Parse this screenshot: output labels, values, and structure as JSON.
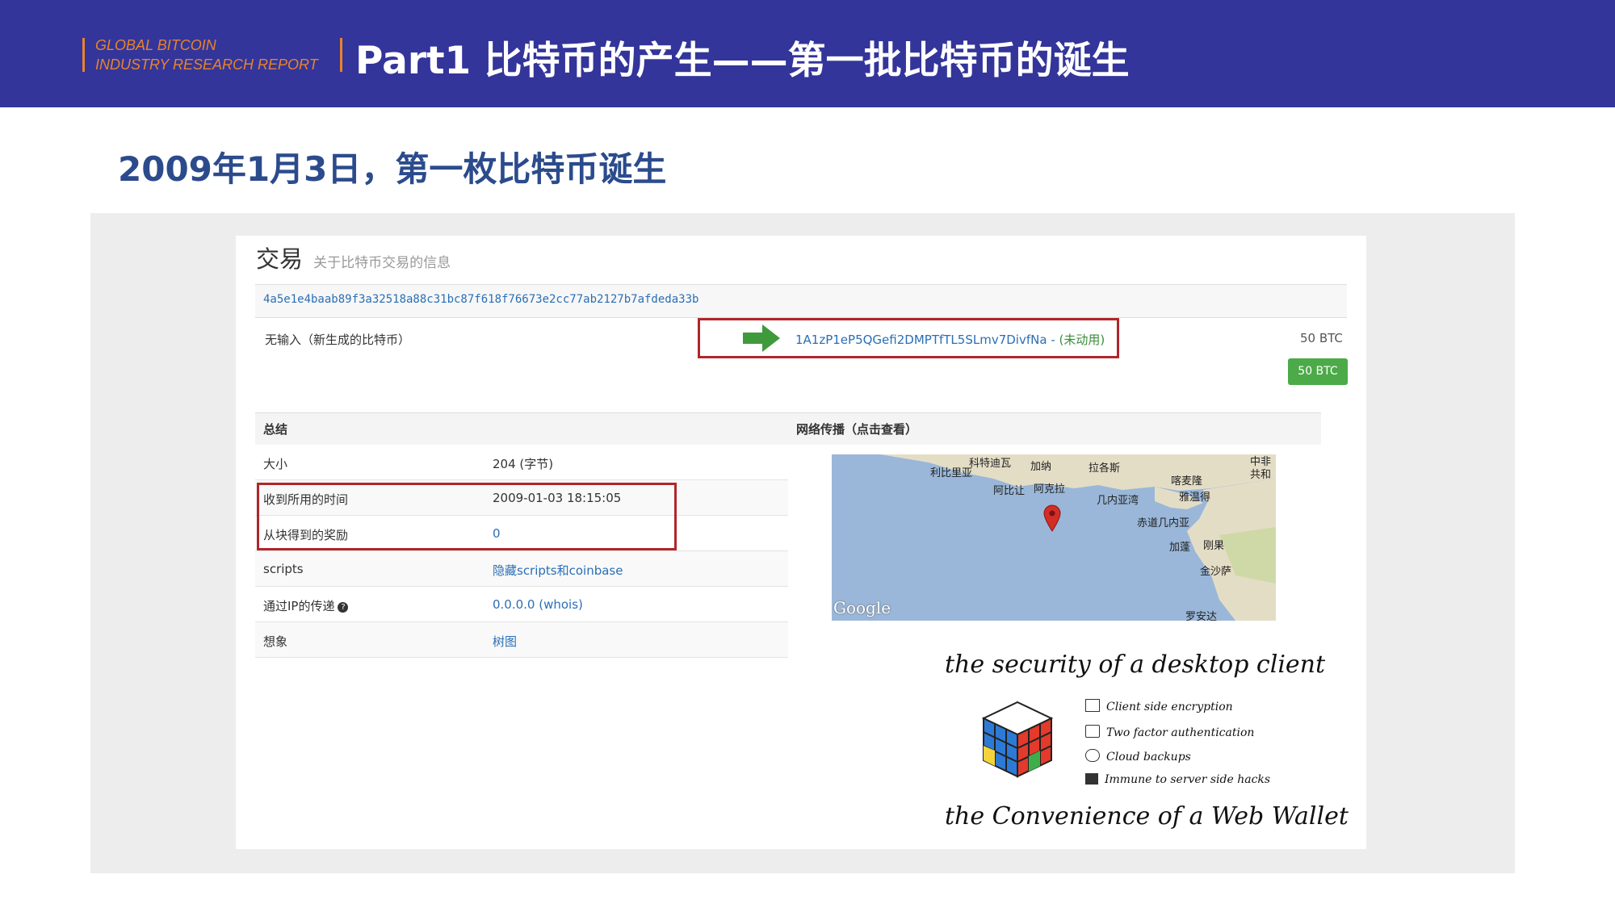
{
  "header": {
    "brand_line1": "GLOBAL BITCOIN",
    "brand_line2": "INDUSTRY RESEARCH REPORT",
    "title": "Part1 比特币的产生——第一批比特币的诞生"
  },
  "subtitle": "2009年1月3日，第一枚比特币诞生",
  "screenshot": {
    "tx_title": "交易",
    "tx_subtitle": "关于比特币交易的信息",
    "tx_hash": "4a5e1e4baab89f3a32518a88c31bc87f618f76673e2cc77ab2127b7afdeda33b",
    "input_label": "无输入（新生成的比特币）",
    "output_address": "1A1zP1eP5QGefi2DMPTfTL5SLmv7DivfNa",
    "output_status": "(未动用)",
    "output_amount": "50 BTC",
    "total_button": "50 BTC",
    "summary_header": "总结",
    "network_header": "网络传播（点击查看）",
    "rows": [
      {
        "key": "大小",
        "value": "204 (字节)"
      },
      {
        "key": "收到所用的时间",
        "value": "2009-01-03 18:15:05"
      },
      {
        "key": "从块得到的奖励",
        "value": "0"
      },
      {
        "key": "scripts",
        "value": "隐藏scripts和coinbase"
      },
      {
        "key": "通过IP的传递",
        "value": "0.0.0.0 (whois)"
      },
      {
        "key": "想象",
        "value": "树图"
      }
    ],
    "map": {
      "labels": [
        "利比里亚",
        "科特迪瓦",
        "加纳",
        "拉各斯",
        "喀麦隆",
        "阿比让",
        "阿克拉",
        "几内亚湾",
        "雅温得",
        "赤道几内亚",
        "加蓬",
        "刚果",
        "金沙萨",
        "罗安达",
        "中非共和",
        "Google"
      ]
    },
    "ad": {
      "headline_top": "the security of a desktop client",
      "features": [
        "Client side encryption",
        "Two factor authentication",
        "Cloud backups",
        "Immune to server side hacks"
      ],
      "headline_bottom": "the Convenience of a Web Wallet"
    }
  },
  "colors": {
    "header_bg": "#33359a",
    "accent": "#e8832a",
    "subtitle": "#2b4b8c",
    "highlight_box": "#b0262a",
    "button": "#4caa49"
  }
}
